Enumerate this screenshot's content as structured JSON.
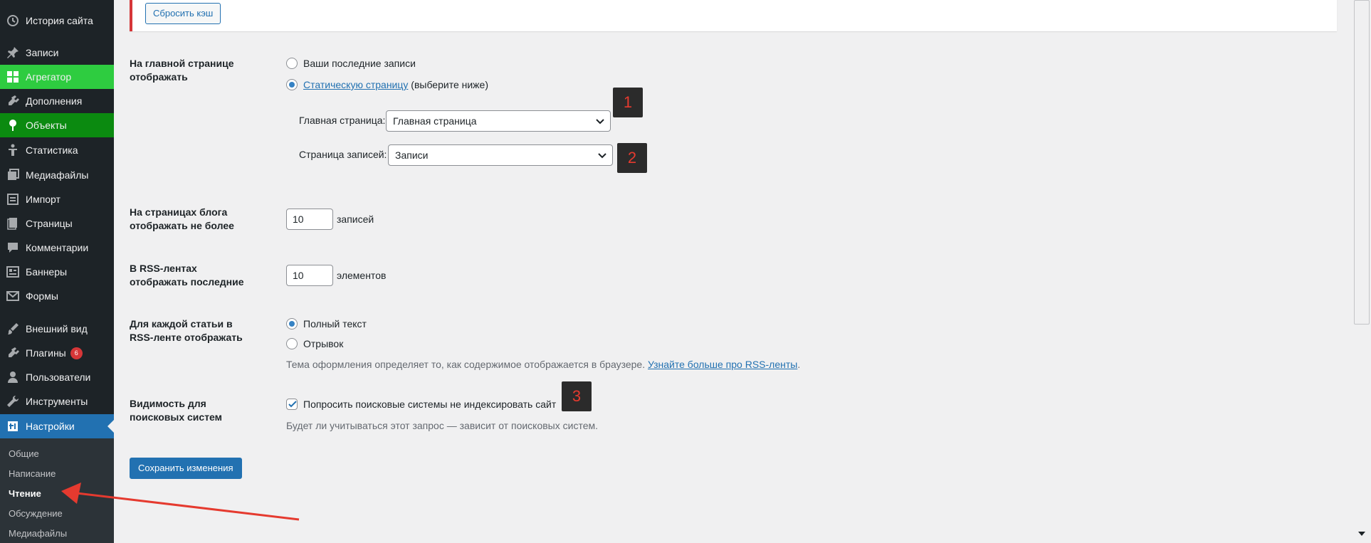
{
  "sidebar": {
    "items": [
      {
        "label": "История сайта",
        "icon": "history-icon"
      },
      {
        "label": "Записи",
        "icon": "pin-icon"
      },
      {
        "label": "Агрегатор",
        "icon": "grid-icon"
      },
      {
        "label": "Дополнения",
        "icon": "plugin-icon"
      },
      {
        "label": "Объекты",
        "icon": "leaf-icon"
      },
      {
        "label": "Статистика",
        "icon": "person-icon"
      },
      {
        "label": "Медиафайлы",
        "icon": "media-icon"
      },
      {
        "label": "Импорт",
        "icon": "import-icon"
      },
      {
        "label": "Страницы",
        "icon": "pages-icon"
      },
      {
        "label": "Комментарии",
        "icon": "comment-icon"
      },
      {
        "label": "Баннеры",
        "icon": "banner-icon"
      },
      {
        "label": "Формы",
        "icon": "mail-icon"
      },
      {
        "label": "Внешний вид",
        "icon": "brush-icon"
      },
      {
        "label": "Плагины",
        "icon": "plugin-icon",
        "badge": "6"
      },
      {
        "label": "Пользователи",
        "icon": "user-icon"
      },
      {
        "label": "Инструменты",
        "icon": "wrench-icon"
      },
      {
        "label": "Настройки",
        "icon": "settings-icon"
      }
    ],
    "submenu": [
      "Общие",
      "Написание",
      "Чтение",
      "Обсуждение",
      "Медиафайлы"
    ],
    "current_submenu": "Чтение"
  },
  "notice": {
    "button_label": "Сбросить кэш",
    "border_color": "#d63638"
  },
  "homepage": {
    "label": "На главной странице отображать",
    "option_latest": "Ваши последние записи",
    "option_static_link": "Статическую страницу",
    "option_static_suffix": "(выберите ниже)",
    "front_label": "Главная страница:",
    "front_value": "Главная страница",
    "posts_label": "Страница записей:",
    "posts_value": "Записи"
  },
  "blog_pages": {
    "label": "На страницах блога отображать не более",
    "value": "10",
    "unit": "записей"
  },
  "rss_items": {
    "label": "В RSS-лентах отображать последние",
    "value": "10",
    "unit": "элементов"
  },
  "rss_content": {
    "label": "Для каждой статьи в RSS-ленте отображать",
    "option_full": "Полный текст",
    "option_excerpt": "Отрывок",
    "desc_prefix": "Тема оформления определяет то, как содержимое отображается в браузере.",
    "desc_link": "Узнайте больше про RSS-ленты",
    "desc_suffix": "."
  },
  "search_visibility": {
    "label": "Видимость для поисковых систем",
    "checkbox_label": "Попросить поисковые системы не индексировать сайт",
    "desc": "Будет ли учитываться этот запрос — зависит от поисковых систем."
  },
  "save_button": "Сохранить изменения",
  "markers": [
    "1",
    "2",
    "3"
  ],
  "colors": {
    "accent": "#2271b1",
    "sidebar_bg": "#1d2327",
    "green": "#2ecc40",
    "dark_green": "#0b8a10",
    "badge": "#d63638"
  }
}
